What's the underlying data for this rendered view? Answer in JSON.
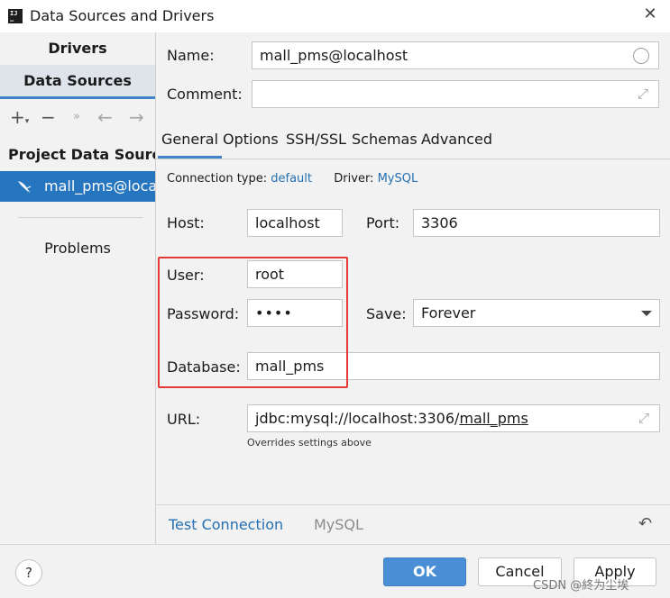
{
  "window": {
    "title": "Data Sources and Drivers"
  },
  "sidebar": {
    "tabs": [
      "Drivers",
      "Data Sources"
    ],
    "section_title": "Project Data Sources",
    "items": [
      {
        "label": "mall_pms@localhost"
      }
    ],
    "problems_label": "Problems"
  },
  "form": {
    "name_label": "Name:",
    "name_value": "mall_pms@localhost",
    "comment_label": "Comment:",
    "comment_value": ""
  },
  "tabs": [
    "General",
    "Options",
    "SSH/SSL",
    "Schemas",
    "Advanced"
  ],
  "active_tab": "General",
  "connection": {
    "type_label": "Connection type:",
    "type_value": "default",
    "driver_label": "Driver:",
    "driver_value": "MySQL"
  },
  "fields": {
    "host_label": "Host:",
    "host_value": "localhost",
    "port_label": "Port:",
    "port_value": "3306",
    "user_label": "User:",
    "user_value": "root",
    "password_label": "Password:",
    "password_value": "••••",
    "save_label": "Save:",
    "save_value": "Forever",
    "database_label": "Database:",
    "database_value": "mall_pms",
    "url_label": "URL:",
    "url_prefix": "jdbc:mysql://localhost:3306/",
    "url_db": "mall_pms",
    "overrides_note": "Overrides settings above"
  },
  "bottom": {
    "test_connection": "Test Connection",
    "driver_name": "MySQL"
  },
  "footer": {
    "help": "?",
    "ok": "OK",
    "cancel": "Cancel",
    "apply": "Apply",
    "watermark": "CSDN @終为尘埃"
  },
  "colors": {
    "accent": "#4083c9",
    "selected_item": "#2675bf",
    "link": "#2470b3",
    "highlight_box": "#e53935"
  },
  "icons": {
    "app": "intellij-icon",
    "close": "close-icon",
    "add": "plus-icon",
    "remove": "minus-icon",
    "more": "double-chevron-icon",
    "back": "arrow-left-icon",
    "forward": "arrow-right-icon",
    "datasource": "mysql-dolphin-icon",
    "expand": "expand-icon",
    "revert": "revert-icon",
    "dropdown": "chevron-down-icon"
  }
}
